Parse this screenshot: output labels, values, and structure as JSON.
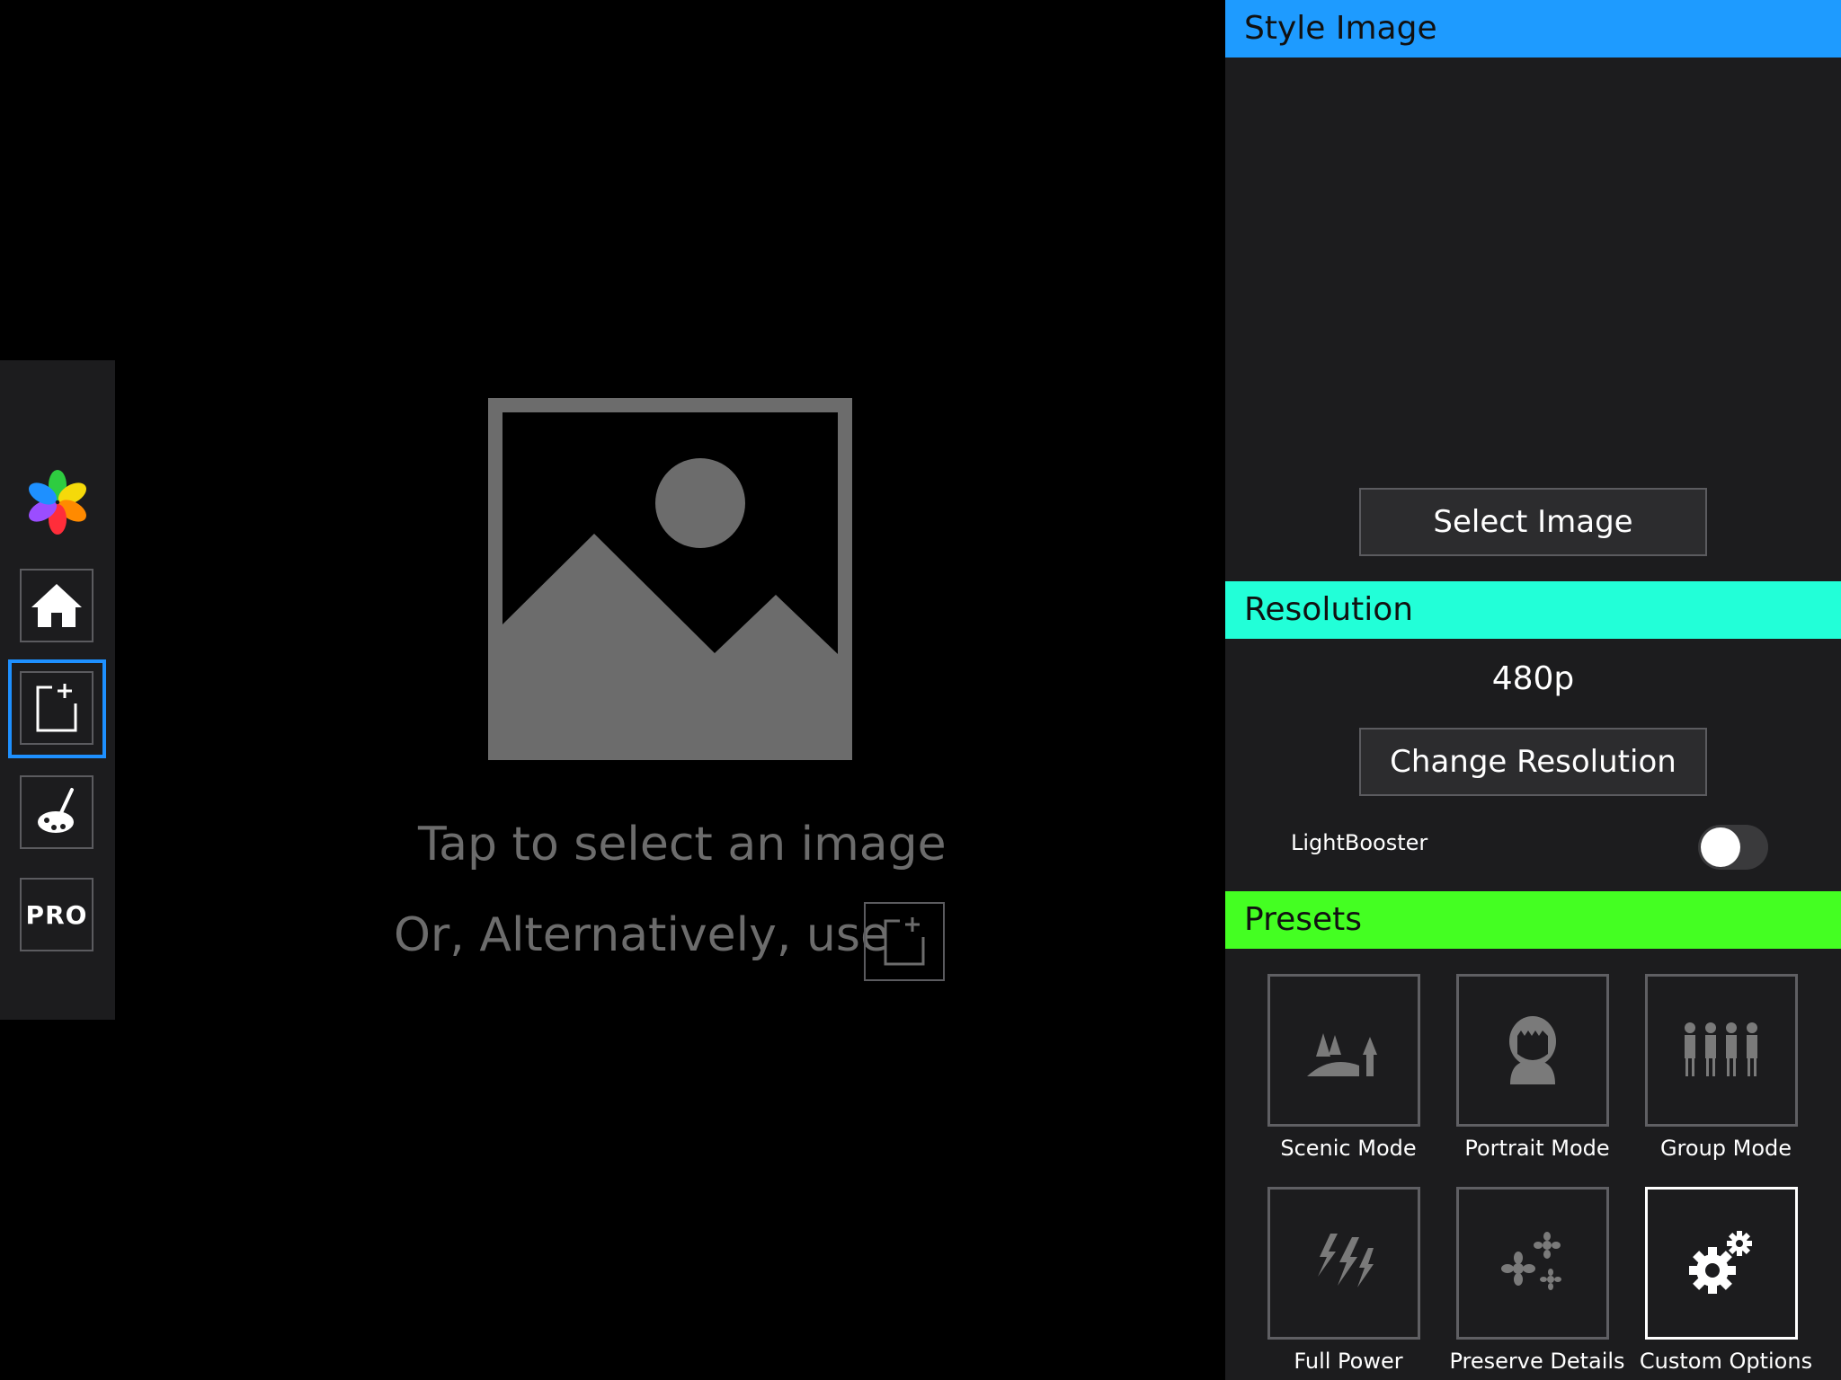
{
  "toolbar": {
    "items": [
      {
        "name": "app-logo-icon"
      },
      {
        "name": "home-icon"
      },
      {
        "name": "add-image-icon"
      },
      {
        "name": "palette-brush-icon"
      },
      {
        "name": "pro",
        "label": "PRO"
      }
    ]
  },
  "canvas": {
    "hint_primary": "Tap to select an image",
    "hint_secondary": "Or, Alternatively, use"
  },
  "panel": {
    "style_image": {
      "title": "Style Image",
      "color": "#1e9bff",
      "button": "Select Image"
    },
    "resolution": {
      "title": "Resolution",
      "color": "#22ffd8",
      "value": "480p",
      "button": "Change Resolution"
    },
    "lightbooster": {
      "label": "LightBooster",
      "enabled": false
    },
    "presets": {
      "title": "Presets",
      "color": "#44ff22",
      "items": [
        {
          "label": "Scenic Mode",
          "icon": "landscape-trees-icon"
        },
        {
          "label": "Portrait Mode",
          "icon": "portrait-person-icon"
        },
        {
          "label": "Group Mode",
          "icon": "group-people-icon"
        },
        {
          "label": "Full Power",
          "icon": "lightning-bolts-icon"
        },
        {
          "label": "Preserve Details",
          "icon": "flowers-details-icon"
        },
        {
          "label": "Custom Options",
          "icon": "gears-icon",
          "selected": true
        }
      ]
    }
  }
}
